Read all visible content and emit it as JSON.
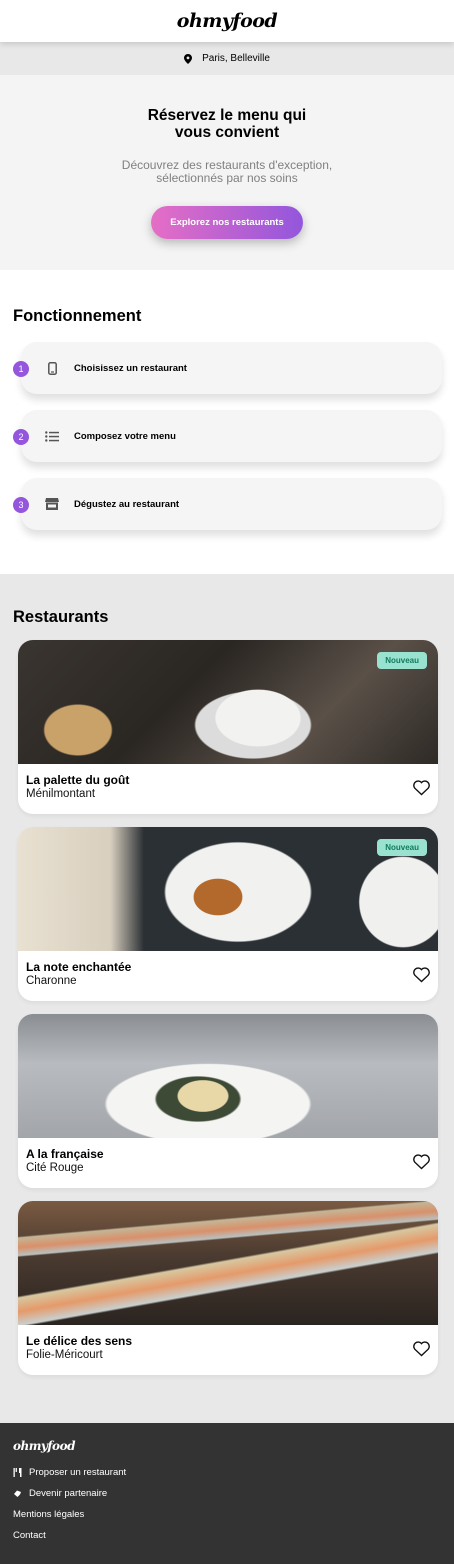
{
  "header": {
    "logo": "ohmyfood"
  },
  "location": {
    "text": "Paris, Belleville",
    "icon": "map-pin-icon"
  },
  "hero": {
    "title": "Réservez le menu qui vous convient",
    "subtitle": "Découvrez des restaurants d'exception, sélectionnés par nos soins",
    "button_label": "Explorez nos restaurants"
  },
  "how": {
    "title": "Fonctionnement",
    "steps": [
      {
        "num": "1",
        "label": "Choisissez un restaurant",
        "icon": "phone-icon"
      },
      {
        "num": "2",
        "label": "Composez votre menu",
        "icon": "list-icon"
      },
      {
        "num": "3",
        "label": "Dégustez au restaurant",
        "icon": "store-icon"
      }
    ]
  },
  "restaurants": {
    "title": "Restaurants",
    "items": [
      {
        "name": "La palette du goût",
        "area": "Ménilmontant",
        "badge": "Nouveau"
      },
      {
        "name": "La note enchantée",
        "area": "Charonne",
        "badge": "Nouveau"
      },
      {
        "name": "A la française",
        "area": "Cité Rouge",
        "badge": ""
      },
      {
        "name": "Le délice des sens",
        "area": "Folie-Méricourt",
        "badge": ""
      }
    ]
  },
  "footer": {
    "logo": "ohmyfood",
    "links": [
      {
        "label": "Proposer un restaurant",
        "icon": "utensils-icon"
      },
      {
        "label": "Devenir partenaire",
        "icon": "handshake-icon"
      },
      {
        "label": "Mentions légales",
        "icon": ""
      },
      {
        "label": "Contact",
        "icon": ""
      }
    ]
  },
  "colors": {
    "accent_start": "#e56ec6",
    "accent_end": "#9356dc",
    "badge_bg": "#99e2d0",
    "footer_bg": "#333333"
  }
}
